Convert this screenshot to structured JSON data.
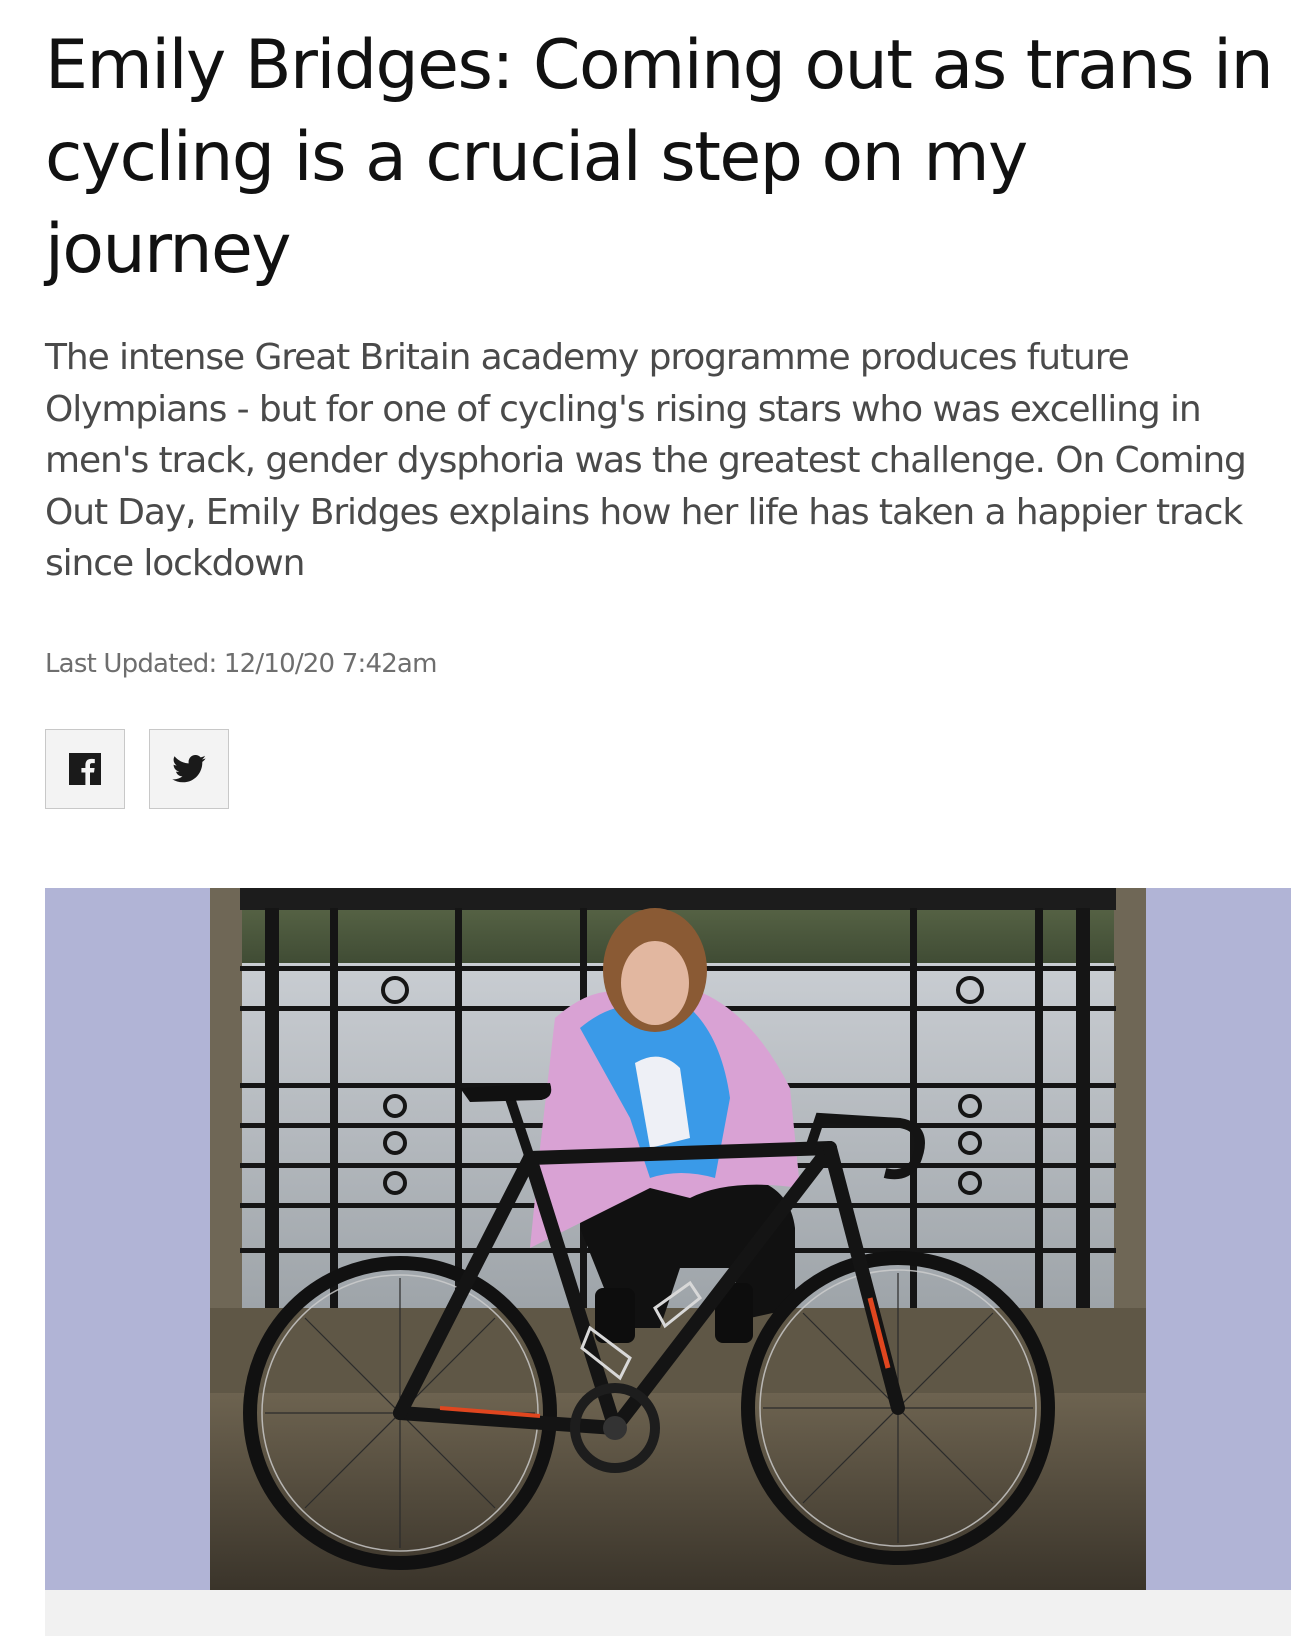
{
  "article": {
    "headline": "Emily Bridges: Coming out as trans in cycling is a crucial step on my journey",
    "standfirst": "The intense Great Britain academy programme produces future Olympians - but for one of cycling's rising stars who was excelling in men's track, gender dysphoria was the greatest challenge. On Coming Out Day, Emily Bridges explains how her life has taken a happier track since lockdown",
    "last_updated": "Last Updated: 12/10/20 7:42am"
  },
  "share": {
    "facebook_icon": "facebook-icon",
    "twitter_icon": "twitter-icon"
  },
  "image": {
    "subject": "photo-of-cyclist-with-flag-and-bike",
    "letterbox_color": "#b1b4d6"
  },
  "colors": {
    "headline": "#111111",
    "standfirst": "#4a4a4a",
    "timestamp": "#6e6e6e",
    "share_bg": "#f3f3f3",
    "flag_blue": "#3a9ae8",
    "flag_pink": "#d9a2d4",
    "flag_white": "#eef0f6"
  }
}
